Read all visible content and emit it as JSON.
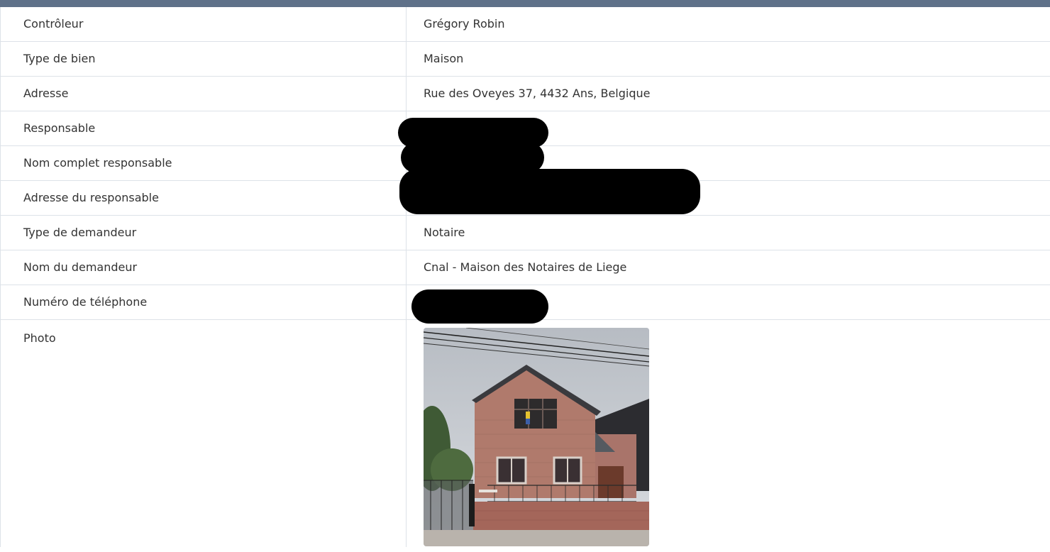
{
  "rows": [
    {
      "label": "Contrôleur",
      "value": "Grégory Robin"
    },
    {
      "label": "Type de bien",
      "value": "Maison"
    },
    {
      "label": "Adresse",
      "value": "Rue des Oveyes 37, 4432 Ans, Belgique"
    },
    {
      "label": "Responsable",
      "value": ""
    },
    {
      "label": "Nom complet responsable",
      "value": ""
    },
    {
      "label": "Adresse du responsable",
      "value": ""
    },
    {
      "label": "Type de demandeur",
      "value": "Notaire"
    },
    {
      "label": "Nom du demandeur",
      "value": "Cnal - Maison des Notaires de Liege"
    },
    {
      "label": "Numéro de téléphone",
      "value": ""
    },
    {
      "label": "Photo",
      "value": ""
    }
  ],
  "colors": {
    "header_bar": "#5f7189",
    "border": "#dde2e8",
    "text": "#333333",
    "redaction": "#000000"
  }
}
